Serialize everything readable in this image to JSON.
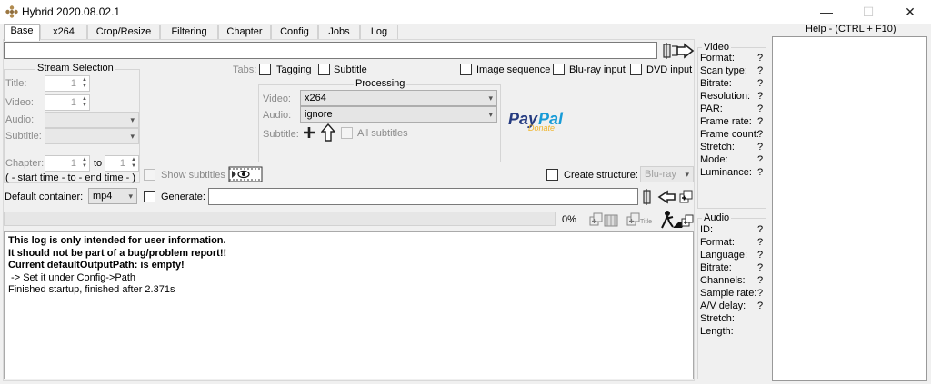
{
  "window": {
    "title": "Hybrid 2020.08.02.1",
    "minimize": "—",
    "maximize": "☐",
    "close": "✕"
  },
  "tabs": [
    "Base",
    "x264",
    "Crop/Resize",
    "Filtering",
    "Chapter",
    "Config",
    "Jobs",
    "Log"
  ],
  "stream_selection": {
    "title": "Stream Selection",
    "title_label": "Title:",
    "title_value": "1",
    "video_label": "Video:",
    "video_value": "1",
    "audio_label": "Audio:",
    "subtitle_label": "Subtitle:",
    "chapter_label": "Chapter:",
    "chapter_from": "1",
    "to_label": "to",
    "chapter_to": "1",
    "time_hint": "( - start time - to - end time - )"
  },
  "tabs_options": {
    "label": "Tabs:",
    "tagging": "Tagging",
    "subtitle": "Subtitle"
  },
  "input_options": {
    "image_sequence": "Image sequence",
    "bluray_input": "Blu-ray input",
    "dvd_input": "DVD input"
  },
  "processing": {
    "title": "Processing",
    "video_label": "Video:",
    "video_value": "x264",
    "audio_label": "Audio:",
    "audio_value": "ignore",
    "subtitle_label": "Subtitle:",
    "all_subtitles": "All subtitles"
  },
  "paypal": {
    "text1": "Pay",
    "text2": "Pal",
    "sub": "Donate"
  },
  "show_subtitles": "Show subtitles",
  "create_structure": {
    "label": "Create structure:",
    "value": "Blu-ray"
  },
  "default_container": {
    "label": "Default container:",
    "value": "mp4"
  },
  "generate": {
    "label": "Generate:"
  },
  "progress": {
    "value": 0,
    "text": "0%"
  },
  "log_lines": [
    {
      "text": "This log is only intended for user information.",
      "bold": true
    },
    {
      "text": "It should not be part of a bug/problem report!!",
      "bold": true
    },
    {
      "text": "Current defaultOutputPath: is empty!",
      "bold": true
    },
    {
      "text": " -> Set it under Config->Path",
      "bold": false
    },
    {
      "text": "Finished startup, finished after 2.371s",
      "bold": false
    }
  ],
  "video_info": {
    "title": "Video",
    "fields": [
      "Format:",
      "Scan type:",
      "Bitrate:",
      "Resolution:",
      "PAR:",
      "Frame rate:",
      "Frame count:",
      "Stretch:",
      "Mode:",
      "Luminance:"
    ],
    "unknown": "?"
  },
  "audio_info": {
    "title": "Audio",
    "fields": [
      "ID:",
      "Format:",
      "Language:",
      "Bitrate:",
      "Channels:",
      "Sample rate:",
      "A/V delay:",
      "Stretch:",
      "Length:"
    ],
    "unknown": "?",
    "unknown_count": 7
  },
  "help": {
    "title": "Help - (CTRL + F10)"
  },
  "icons": {
    "title_small": "Title"
  }
}
